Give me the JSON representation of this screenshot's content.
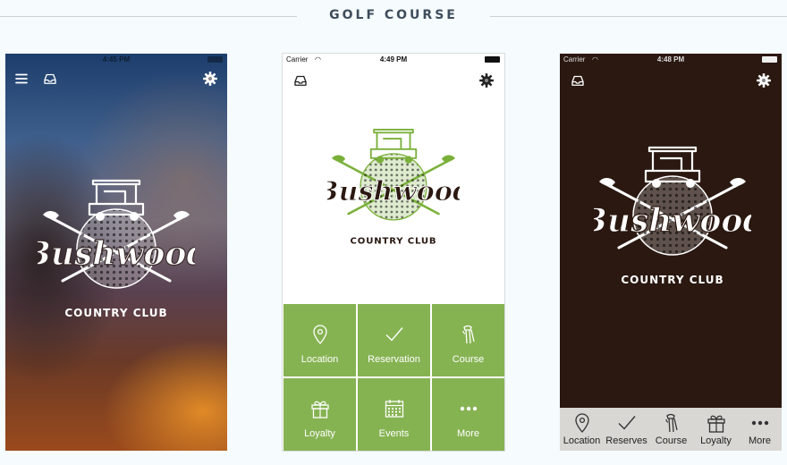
{
  "header": {
    "title": "GOLF COURSE"
  },
  "colors": {
    "accent_green": "#86b352",
    "dark_brown": "#2a1811",
    "tabbar": "#d9d7d3"
  },
  "logo": {
    "name": "Bushwood",
    "subtitle": "COUNTRY CLUB"
  },
  "phone1": {
    "status": {
      "carrier": "",
      "time": "4:45 PM"
    },
    "icons": [
      "menu-icon",
      "inbox-icon",
      "gear-icon"
    ]
  },
  "phone2": {
    "status": {
      "carrier": "Carrier",
      "time": "4:49 PM"
    },
    "icons": [
      "inbox-icon",
      "gear-icon"
    ],
    "tiles": [
      {
        "label": "Location",
        "icon": "location-pin-icon"
      },
      {
        "label": "Reservation",
        "icon": "checkmark-icon"
      },
      {
        "label": "Course",
        "icon": "golf-bag-icon"
      },
      {
        "label": "Loyalty",
        "icon": "gift-icon"
      },
      {
        "label": "Events",
        "icon": "calendar-icon"
      },
      {
        "label": "More",
        "icon": "more-dots-icon"
      }
    ]
  },
  "phone3": {
    "status": {
      "carrier": "Carrier",
      "time": "4:48 PM"
    },
    "icons": [
      "inbox-icon",
      "gear-icon"
    ],
    "tabs": [
      {
        "label": "Location",
        "icon": "location-pin-icon"
      },
      {
        "label": "Reserves",
        "icon": "checkmark-icon"
      },
      {
        "label": "Course",
        "icon": "golf-bag-icon"
      },
      {
        "label": "Loyalty",
        "icon": "gift-icon"
      },
      {
        "label": "More",
        "icon": "more-dots-icon"
      }
    ]
  }
}
